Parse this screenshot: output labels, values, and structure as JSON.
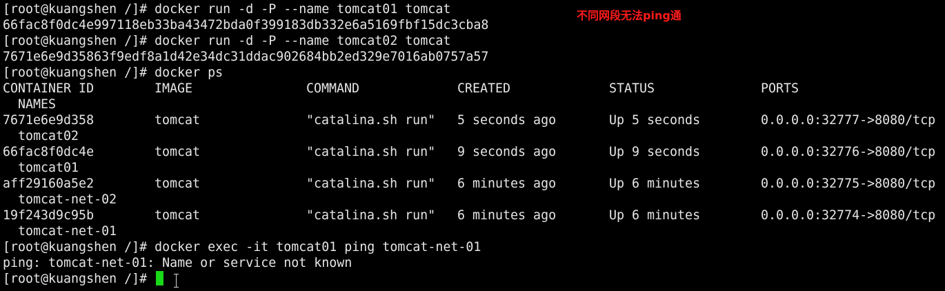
{
  "terminal": {
    "lines_top": [
      "[root@kuangshen /]# docker run -d -P --name tomcat01 tomcat",
      "66fac8f0dc4e997118eb33ba43472bda0f399183db332e6a5169fbf15dc3cba8",
      "[root@kuangshen /]# docker run -d -P --name tomcat02 tomcat",
      "7671e6e9d35863f9edf8a1d42e34dc31ddac902684bb2ed329e7016ab0757a57",
      "[root@kuangshen /]# docker ps"
    ],
    "table": {
      "headers": {
        "container_id": "CONTAINER ID",
        "image": "IMAGE",
        "command": "COMMAND",
        "created": "CREATED",
        "status": "STATUS",
        "ports": "PORTS",
        "names": "  NAMES"
      },
      "rows": [
        {
          "container_id": "7671e6e9d358",
          "image": "tomcat",
          "command": "\"catalina.sh run\"",
          "created": "5 seconds ago",
          "status": "Up 5 seconds",
          "ports": "0.0.0.0:32777->8080/tcp",
          "names": "  tomcat02"
        },
        {
          "container_id": "66fac8f0dc4e",
          "image": "tomcat",
          "command": "\"catalina.sh run\"",
          "created": "9 seconds ago",
          "status": "Up 9 seconds",
          "ports": "0.0.0.0:32776->8080/tcp",
          "names": "  tomcat01"
        },
        {
          "container_id": "aff29160a5e2",
          "image": "tomcat",
          "command": "\"catalina.sh run\"",
          "created": "6 minutes ago",
          "status": "Up 6 minutes",
          "ports": "0.0.0.0:32775->8080/tcp",
          "names": "  tomcat-net-02"
        },
        {
          "container_id": "19f243d9c95b",
          "image": "tomcat",
          "command": "\"catalina.sh run\"",
          "created": "6 minutes ago",
          "status": "Up 6 minutes",
          "ports": "0.0.0.0:32774->8080/tcp",
          "names": "  tomcat-net-01"
        }
      ]
    },
    "lines_bottom": [
      "[root@kuangshen /]# docker exec -it tomcat01 ping tomcat-net-01",
      "ping: tomcat-net-01: Name or service not known"
    ],
    "prompt": "[root@kuangshen /]# ",
    "cursor_color": "#18d818",
    "background_color": "#000000",
    "text_color": "#e6e6e6"
  },
  "annotation": {
    "text": "不同网段无法ping通",
    "color": "#ff1a1a"
  }
}
